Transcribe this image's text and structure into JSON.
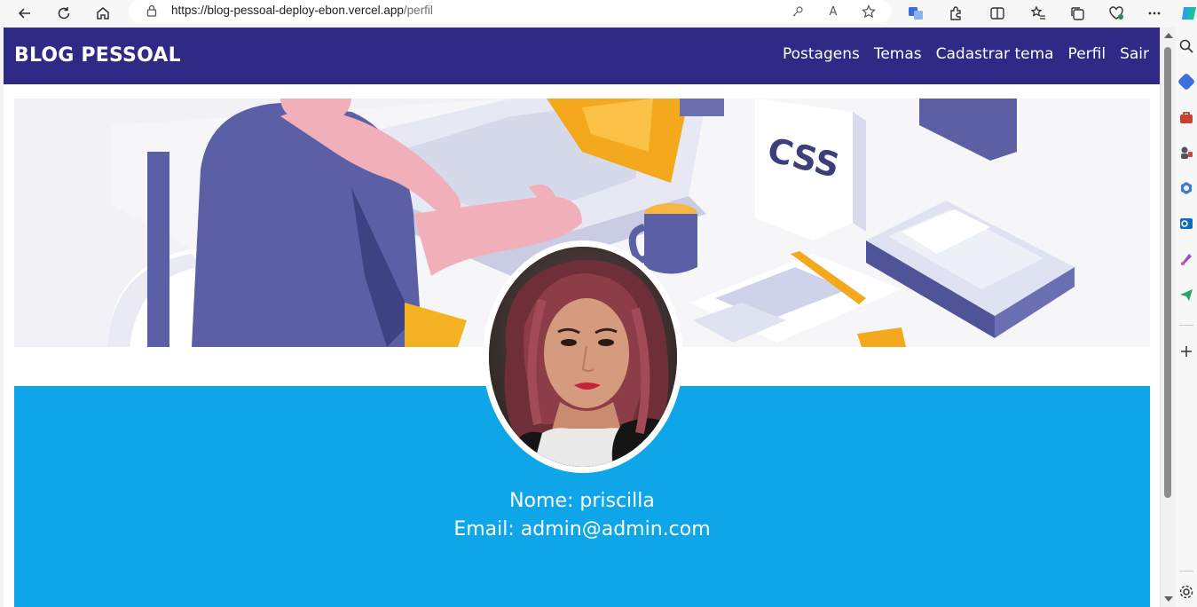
{
  "browser": {
    "url_host": "https://blog-pessoal-deploy-ebon.vercel.app",
    "url_path": "/perfil"
  },
  "navbar": {
    "brand": "BLOG PESSOAL",
    "links": [
      "Postagens",
      "Temas",
      "Cadastrar tema",
      "Perfil",
      "Sair"
    ]
  },
  "profile": {
    "name_line": "Nome: priscilla",
    "email_line": "Email: admin@admin.com"
  },
  "colors": {
    "navbar": "#2f2a85",
    "panel": "#0ea5e9"
  }
}
